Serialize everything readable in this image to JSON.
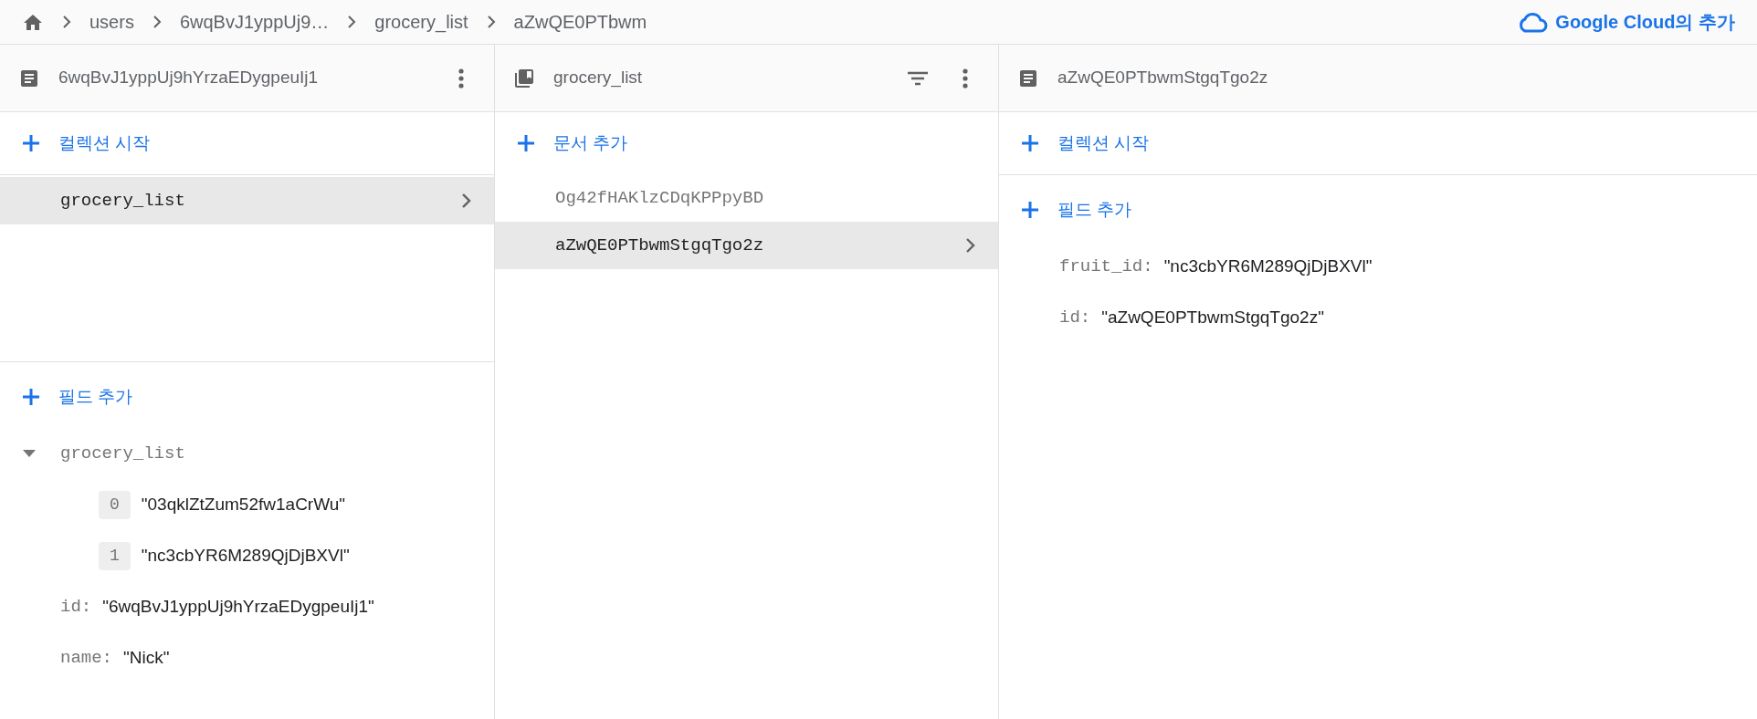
{
  "breadcrumb": [
    {
      "label": "users"
    },
    {
      "label": "6wqBvJ1yppUj9…"
    },
    {
      "label": "grocery_list"
    },
    {
      "label": "aZwQE0PTbwm"
    }
  ],
  "top_link": "Google Cloud의 추가",
  "panels": [
    {
      "kind": "document",
      "title": "6wqBvJ1yppUj9hYrzaEDygpeuIj1",
      "add_collection": "컬렉션 시작",
      "collections": [
        {
          "label": "grocery_list",
          "selected": true
        }
      ],
      "add_field": "필드 추가",
      "fields": [
        {
          "kind": "array",
          "key": "grocery_list",
          "expanded": true,
          "items": [
            {
              "index": "0",
              "value": "\"03qklZtZum52fw1aCrWu\""
            },
            {
              "index": "1",
              "value": "\"nc3cbYR6M289QjDjBXVl\""
            }
          ]
        },
        {
          "kind": "string",
          "key": "id:",
          "value": "\"6wqBvJ1yppUj9hYrzaEDygpeuIj1\""
        },
        {
          "kind": "string",
          "key": "name:",
          "value": "\"Nick\""
        }
      ]
    },
    {
      "kind": "collection",
      "title": "grocery_list",
      "add_document": "문서 추가",
      "documents": [
        {
          "label": "Og42fHAKlzCDqKPPpyBD",
          "selected": false
        },
        {
          "label": "aZwQE0PTbwmStgqTgo2z",
          "selected": true
        }
      ]
    },
    {
      "kind": "document",
      "title": "aZwQE0PTbwmStgqTgo2z",
      "add_collection": "컬렉션 시작",
      "add_field": "필드 추가",
      "fields": [
        {
          "kind": "string",
          "key": "fruit_id:",
          "value": "\"nc3cbYR6M289QjDjBXVl\""
        },
        {
          "kind": "string",
          "key": "id:",
          "value": "\"aZwQE0PTbwmStgqTgo2z\""
        }
      ]
    }
  ]
}
